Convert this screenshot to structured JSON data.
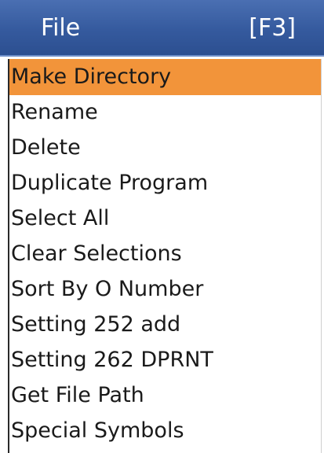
{
  "menu": {
    "title": "File",
    "shortcut": "[F3]",
    "colors": {
      "header": "#3a5fa4",
      "selected": "#f2943a",
      "text": "#1a1a1a"
    },
    "items": [
      {
        "label": "Make Directory",
        "selected": true
      },
      {
        "label": "Rename",
        "selected": false
      },
      {
        "label": "Delete",
        "selected": false
      },
      {
        "label": "Duplicate Program",
        "selected": false
      },
      {
        "label": "Select All",
        "selected": false
      },
      {
        "label": "Clear Selections",
        "selected": false
      },
      {
        "label": "Sort By O Number",
        "selected": false
      },
      {
        "label": "Setting 252 add",
        "selected": false
      },
      {
        "label": "Setting 262 DPRNT",
        "selected": false
      },
      {
        "label": "Get File Path",
        "selected": false
      },
      {
        "label": "Special Symbols",
        "selected": false
      }
    ]
  }
}
